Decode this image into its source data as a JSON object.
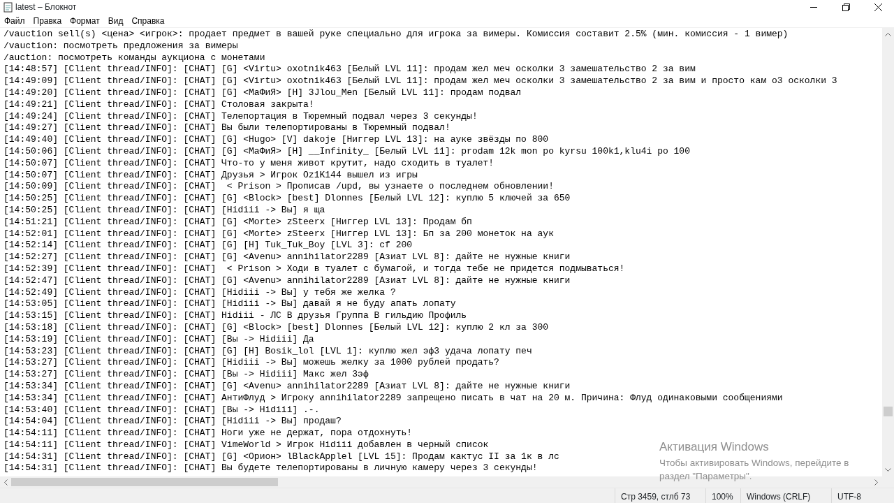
{
  "window": {
    "title": "latest – Блокнот"
  },
  "menu": [
    "Файл",
    "Правка",
    "Формат",
    "Вид",
    "Справка"
  ],
  "lines": [
    "/vauction sell(s) <цена> <игрок>: продает предмет в вашей руке специально для игрока за вимеры. Комиссия составит 2.5% (мин. комиссия - 1 вимер)",
    "/vauction: посмотреть предложения за вимеры",
    "/auction: посмотреть команды аукциона с монетами",
    "[14:48:57] [Client thread/INFO]: [CHAT] [G] <Virtu> oxotnik463 [Белый LVL 11]: продам жел меч осколки 3 замешательство 2 за вим",
    "[14:49:09] [Client thread/INFO]: [CHAT] [G] <Virtu> oxotnik463 [Белый LVL 11]: продам жел меч осколки 3 замешательство 2 за вим и просто кам о3 осколки 3",
    "[14:49:20] [Client thread/INFO]: [CHAT] [G] <МаФиЯ> [H] 3Jlou_Men [Белый LVL 11]: продам подвал",
    "[14:49:21] [Client thread/INFO]: [CHAT] Столовая закрыта!",
    "[14:49:24] [Client thread/INFO]: [CHAT] Телепортация в Тюремный подвал через 3 секунды!",
    "[14:49:27] [Client thread/INFO]: [CHAT] Вы были телепортированы в Тюремный подвал!",
    "[14:49:40] [Client thread/INFO]: [CHAT] [G] <Hugo> [V] dakoje [Ниггер LVL 13]: на ауке звёзды по 800",
    "[14:50:06] [Client thread/INFO]: [CHAT] [G] <МаФиЯ> [H] __Infinity_ [Белый LVL 11]: prodam 12k mon po kyrsu 100k1,klu4i po 100",
    "[14:50:07] [Client thread/INFO]: [CHAT] Что-то у меня живот крутит, надо сходить в туалет!",
    "[14:50:07] [Client thread/INFO]: [CHAT] Друзья > Игрок Oz1K144 вышел из игры",
    "[14:50:09] [Client thread/INFO]: [CHAT]  < Prison > Прописав /upd, вы узнаете о последнем обновлении!",
    "[14:50:25] [Client thread/INFO]: [CHAT] [G] <Block> [best] Dlonnes [Белый LVL 12]: куплю 5 ключей за 650",
    "[14:50:25] [Client thread/INFO]: [CHAT] [Hidiii -> Вы] я ща",
    "[14:51:21] [Client thread/INFO]: [CHAT] [G] <Morte> zSteerx [Ниггер LVL 13]: Продам бп",
    "[14:52:01] [Client thread/INFO]: [CHAT] [G] <Morte> zSteerx [Ниггер LVL 13]: Бп за 200 монеток на аук",
    "[14:52:14] [Client thread/INFO]: [CHAT] [G] [H] Tuk_Tuk_Boy [LVL 3]: cf 200",
    "[14:52:27] [Client thread/INFO]: [CHAT] [G] <Avenu> annihilator2289 [Азиат LVL 8]: дайте не нужные книги",
    "[14:52:39] [Client thread/INFO]: [CHAT]  < Prison > Ходи в туалет с бумагой, и тогда тебе не придется подмываться!",
    "[14:52:47] [Client thread/INFO]: [CHAT] [G] <Avenu> annihilator2289 [Азиат LVL 8]: дайте не нужные книги",
    "[14:52:49] [Client thread/INFO]: [CHAT] [Hidiii -> Вы] у тебя же желка ?",
    "[14:53:05] [Client thread/INFO]: [CHAT] [Hidiii -> Вы] давай я не буду апать лопату",
    "[14:53:15] [Client thread/INFO]: [CHAT] Hidiii - ЛС В друзья Группа В гильдию Профиль",
    "[14:53:18] [Client thread/INFO]: [CHAT] [G] <Block> [best] Dlonnes [Белый LVL 12]: куплю 2 кл за 300",
    "[14:53:19] [Client thread/INFO]: [CHAT] [Вы -> Hidiii] Да",
    "[14:53:23] [Client thread/INFO]: [CHAT] [G] [H] Bosik_lol [LVL 1]: куплю жел эф3 удача лопату печ",
    "[14:53:27] [Client thread/INFO]: [CHAT] [Hidiii -> Вы] можешь желку за 1000 рублей продать?",
    "[14:53:27] [Client thread/INFO]: [CHAT] [Вы -> Hidiii] Макс жел 3эф",
    "[14:53:34] [Client thread/INFO]: [CHAT] [G] <Avenu> annihilator2289 [Азиат LVL 8]: дайте не нужные книги",
    "[14:53:34] [Client thread/INFO]: [CHAT] АнтиФлуд > Игроку annihilator2289 запрещено писать в чат на 20 м. Причина: Флуд одинаковыми сообщениями",
    "[14:53:40] [Client thread/INFO]: [CHAT] [Вы -> Hidiii] .-.",
    "[14:54:04] [Client thread/INFO]: [CHAT] [Hidiii -> Вы] продаш?",
    "[14:54:11] [Client thread/INFO]: [CHAT] Ноги уже не держат, пора отдохнуть!",
    "[14:54:11] [Client thread/INFO]: [CHAT] VimeWorld > Игрок Hidiii добавлен в черный список",
    "[14:54:31] [Client thread/INFO]: [CHAT] [G] <Орион> lBlackApplel [LVL 15]: Продам кактус II за 1к в лс",
    "[14:54:31] [Client thread/INFO]: [CHAT] Вы будете телепортированы в личную камеру через 3 секунды!"
  ],
  "activation_notice": {
    "title": "Активация Windows",
    "text": "Чтобы активировать Windows, перейдите в раздел \"Параметры\"."
  },
  "status_bar": [
    "Стр 3459, стлб 73",
    "100%",
    "Windows (CRLF)",
    "UTF-8"
  ]
}
